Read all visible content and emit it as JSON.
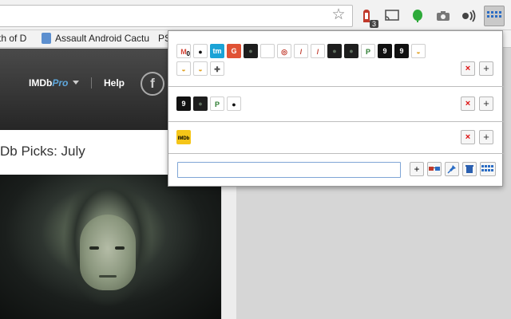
{
  "bookmarks": {
    "item1_label": "th of D",
    "item2_label": "Assault Android Cactu",
    "item3_label": "PS"
  },
  "extension_badge": "3",
  "page": {
    "imdbpro_imdb": "IMDb",
    "imdbpro_pro": "Pro",
    "help_label": "Help",
    "facebook_glyph": "f",
    "picks_title": "Db Picks: July"
  },
  "popup": {
    "group1_icons": [
      {
        "name": "gmail-icon",
        "glyph": "M",
        "bg": "#ffffff",
        "fg": "#d44638",
        "badge": "0"
      },
      {
        "name": "github-icon",
        "glyph": "●",
        "bg": "#ffffff",
        "fg": "#111111"
      },
      {
        "name": "tm-icon",
        "glyph": "tm",
        "bg": "#1ba3d6",
        "fg": "#ffffff"
      },
      {
        "name": "g-red-icon",
        "glyph": "G",
        "bg": "#e05235",
        "fg": "#ffffff"
      },
      {
        "name": "circle-dark-icon",
        "glyph": "●",
        "bg": "#1e1e1e",
        "fg": "#5f6f5f"
      },
      {
        "name": "blank-page-icon",
        "glyph": "",
        "bg": "#ffffff",
        "fg": "#999999"
      },
      {
        "name": "ring-icon",
        "glyph": "◎",
        "bg": "#ffffff",
        "fg": "#c0392b"
      },
      {
        "name": "slash-icon",
        "glyph": "/",
        "bg": "#ffffff",
        "fg": "#c0392b"
      },
      {
        "name": "slash-icon-2",
        "glyph": "/",
        "bg": "#ffffff",
        "fg": "#c0392b"
      },
      {
        "name": "circle-dark-icon-2",
        "glyph": "●",
        "bg": "#1e1e1e",
        "fg": "#5f6f5f"
      },
      {
        "name": "circle-dark-icon-3",
        "glyph": "●",
        "bg": "#1e1e1e",
        "fg": "#5f6f5f"
      },
      {
        "name": "p-green-icon",
        "glyph": "P",
        "bg": "#ffffff",
        "fg": "#2e7d32"
      },
      {
        "name": "nine-icon",
        "glyph": "9",
        "bg": "#111111",
        "fg": "#ffffff"
      },
      {
        "name": "nine-icon-2",
        "glyph": "9",
        "bg": "#111111",
        "fg": "#ffffff"
      },
      {
        "name": "chrome-store-icon",
        "glyph": "◒",
        "bg": "#ffffff",
        "fg": "#e0a020"
      }
    ],
    "group1_icons_row2": [
      {
        "name": "chrome-store-icon-2",
        "glyph": "◒",
        "bg": "#ffffff",
        "fg": "#e0a020"
      },
      {
        "name": "chrome-store-icon-3",
        "glyph": "◒",
        "bg": "#ffffff",
        "fg": "#e0a020"
      },
      {
        "name": "puzzle-icon",
        "glyph": "✚",
        "bg": "#ffffff",
        "fg": "#555555"
      }
    ],
    "group2_icons": [
      {
        "name": "nine-icon-3",
        "glyph": "9",
        "bg": "#111111",
        "fg": "#ffffff"
      },
      {
        "name": "circle-dark-icon-4",
        "glyph": "●",
        "bg": "#1e1e1e",
        "fg": "#5f6f5f"
      },
      {
        "name": "p-green-icon-2",
        "glyph": "P",
        "bg": "#ffffff",
        "fg": "#2e7d32"
      },
      {
        "name": "github-icon-2",
        "glyph": "●",
        "bg": "#ffffff",
        "fg": "#111111"
      }
    ],
    "group3_icons": [
      {
        "name": "imdb-icon",
        "glyph": "IMDb",
        "bg": "#f5c518",
        "fg": "#000000"
      }
    ],
    "remove_glyph": "×",
    "add_glyph": "+",
    "new_group_input_value": "",
    "tool_add_glyph": "+"
  }
}
